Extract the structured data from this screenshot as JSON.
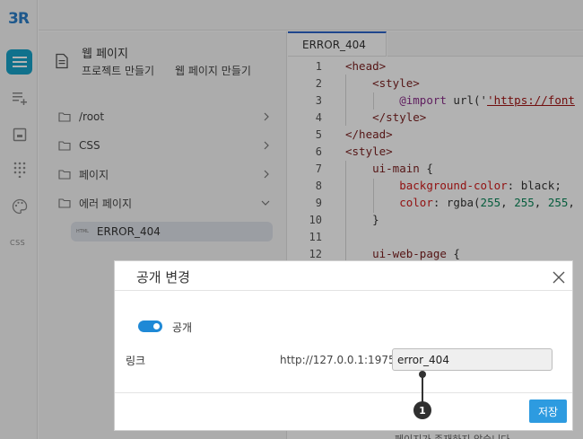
{
  "app": {
    "logo": "3R"
  },
  "rail": {
    "items": [
      {
        "icon": "menu-icon",
        "active": true
      },
      {
        "icon": "add-list-icon"
      },
      {
        "icon": "image-icon"
      },
      {
        "icon": "grid-dots-icon"
      },
      {
        "icon": "palette-icon"
      }
    ],
    "css_label": "CSS"
  },
  "explorer": {
    "title": "웹 페이지",
    "breadcrumb": [
      "프로젝트 만들기",
      "웹 페이지 만들기"
    ],
    "tree": [
      {
        "label": "/root",
        "expanded": false
      },
      {
        "label": "CSS",
        "expanded": false
      },
      {
        "label": "페이지",
        "expanded": false
      },
      {
        "label": "에러 페이지",
        "expanded": true
      }
    ],
    "selected_file": {
      "label": "ERROR_404",
      "type_tag": "HTML"
    }
  },
  "editor": {
    "tab": "ERROR_404",
    "line_numbers": [
      "1",
      "2",
      "3",
      "4",
      "5",
      "6",
      "7",
      "8",
      "9",
      "10",
      "11",
      "12"
    ]
  },
  "dialog": {
    "title": "공개 변경",
    "toggle_label": "공개",
    "toggle_on": true,
    "link_label": "링크",
    "link_prefix": "http://127.0.0.1:1975/",
    "link_value": "error_404",
    "save_label": "저장"
  },
  "callout": {
    "number": "1"
  },
  "background_text": "페이지가 존재하지 않습니다"
}
